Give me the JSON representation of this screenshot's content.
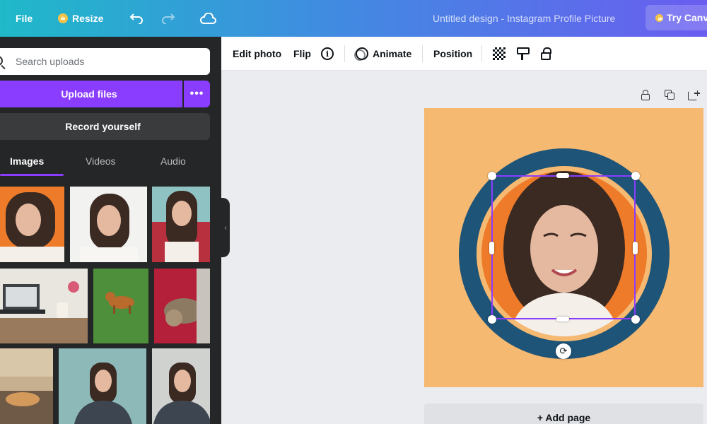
{
  "topbar": {
    "file_label": "File",
    "resize_label": "Resize",
    "undo_icon": "undo-icon",
    "redo_icon": "redo-icon",
    "cloud_icon": "cloud-icon",
    "design_title": "Untitled design - Instagram Profile Picture",
    "try_label": "Try Canv"
  },
  "panel": {
    "search_placeholder": "Search uploads",
    "upload_label": "Upload files",
    "more_label": "•••",
    "record_label": "Record yourself",
    "tabs": [
      {
        "label": "Images"
      },
      {
        "label": "Videos"
      },
      {
        "label": "Audio"
      }
    ],
    "collapse_label": "‹"
  },
  "toolbar": {
    "edit_photo": "Edit photo",
    "flip": "Flip",
    "animate": "Animate",
    "position": "Position"
  },
  "canvas": {
    "add_page": "+ Add page",
    "background_color": "#f5b971",
    "ring_color": "#1d5478",
    "selection_color": "#8b3dff"
  }
}
